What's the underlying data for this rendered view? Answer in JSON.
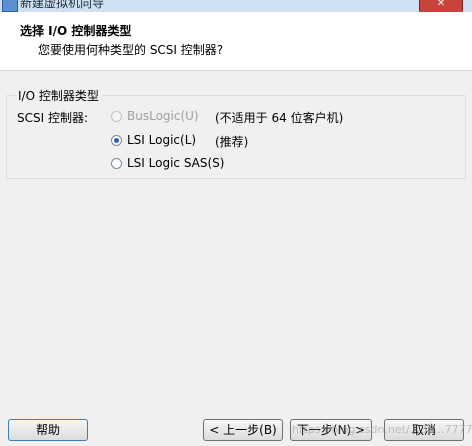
{
  "window": {
    "title": "新建虚拟机向导"
  },
  "header": {
    "title": "选择 I/O 控制器类型",
    "subtitle": "您要使用何种类型的 SCSI 控制器?"
  },
  "group": {
    "legend": "I/O 控制器类型",
    "scsi_label": "SCSI 控制器:",
    "options": [
      {
        "label": "BusLogic(U)",
        "note": "(不适用于 64 位客户机)",
        "checked": false,
        "disabled": true
      },
      {
        "label": "LSI Logic(L)",
        "note": "(推荐)",
        "checked": true,
        "disabled": false
      },
      {
        "label": "LSI Logic SAS(S)",
        "note": "",
        "checked": false,
        "disabled": false
      }
    ]
  },
  "buttons": {
    "help": "帮助",
    "back": "< 上一步(B)",
    "next": "下一步(N) >",
    "cancel": "取消"
  },
  "watermark": "https://blog.csdn.net/...36...7777",
  "icons": {
    "app": "vm-wizard-icon",
    "close": "close-icon"
  }
}
